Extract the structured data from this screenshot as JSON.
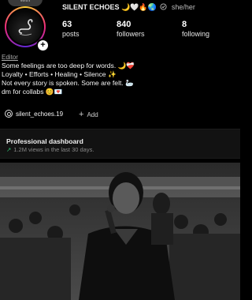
{
  "story_note": {
    "text": "with"
  },
  "profile": {
    "display_name": "SILENT ECHOES 🌙🤍🔥🌏",
    "pronouns": "she/her",
    "stats": [
      {
        "value": "63",
        "label": "posts"
      },
      {
        "value": "840",
        "label": "followers"
      },
      {
        "value": "8",
        "label": "following"
      }
    ],
    "editor_label": "Editor",
    "bio_lines": [
      "Some feelings are too deep for words. 🌙❤️‍🩹",
      "Loyalty • Efforts • Healing • Silence ✨",
      "Not every story is spoken. Some are felt. 🦢",
      "dm for collabs 😊💌"
    ]
  },
  "links": {
    "threads_handle": "silent_echoes.19",
    "add_label": "Add"
  },
  "dashboard": {
    "title": "Professional dashboard",
    "subtitle": "1.2M views in the last 30 days."
  },
  "icons": {
    "avatar_add": "plus-icon",
    "threads": "threads-icon",
    "add": "plus-icon",
    "trend": "trend-up-icon"
  },
  "colors": {
    "trend_green": "#2fbf71",
    "background": "#000000",
    "dashboard_bg": "#121212"
  }
}
